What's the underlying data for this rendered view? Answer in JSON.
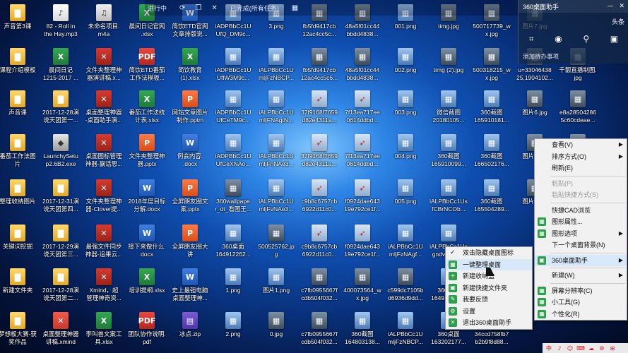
{
  "topbar": {
    "items": [
      "进行中",
      "已完成(所有任务)",
      "已完成 存任务"
    ],
    "icons": [
      "refresh-icon",
      "copy-icon",
      "close-icon",
      "grid-icon"
    ]
  },
  "helper": {
    "title": "360桌面助手",
    "sub": [
      "头条"
    ],
    "footer": "添加待办事项"
  },
  "desktop_icons": [
    {
      "label": "声音第3课",
      "type": "folder",
      "glyph": "▇"
    },
    {
      "label": "82 - Roll in\nthe Hay.mp3",
      "type": "mp3",
      "glyph": "♪"
    },
    {
      "label": "未命名项目.\nm4a",
      "type": "m4a",
      "glyph": "♫"
    },
    {
      "label": "晨间日记官网\n.xlsx",
      "type": "xlsx",
      "glyph": "X"
    },
    {
      "label": "简饮ETD官网\n文章排版说...",
      "type": "docx",
      "glyph": "W"
    },
    {
      "label": "iADPBbCc1U\nUfQ_DM9c...",
      "type": "png",
      "glyph": "▦"
    },
    {
      "label": "3.png",
      "type": "png",
      "glyph": "▦"
    },
    {
      "label": "fb5fd9417cb\n12ac4cc5c...",
      "type": "jpg",
      "glyph": "▦"
    },
    {
      "label": "48a5f01cc44\nbbdd4838...",
      "type": "jpg",
      "glyph": "▦"
    },
    {
      "label": "001.png",
      "type": "png",
      "glyph": "▦"
    },
    {
      "label": "timg.jpg",
      "type": "jpg",
      "glyph": "▦"
    },
    {
      "label": "500717739_w\nx.jpg",
      "type": "jpg",
      "glyph": "▦"
    },
    {
      "label": "图片7.jpg",
      "type": "jpg",
      "glyph": "▦"
    },
    {
      "label": "课程介绍模板",
      "type": "folder",
      "glyph": "▇"
    },
    {
      "label": "晨间日记\n1215-2017 ...",
      "type": "xlsx",
      "glyph": "X"
    },
    {
      "label": "文件夹整理神\n器演讲稿.x...",
      "type": "app",
      "glyph": "✕"
    },
    {
      "label": "简饮ETD番茄\n工作法模板...",
      "type": "pdf",
      "glyph": "PDF"
    },
    {
      "label": "简饮教育\n(1).xlsx",
      "type": "xlsx",
      "glyph": "X"
    },
    {
      "label": "iADPBbCc1U\nUflW3M9c...",
      "type": "png",
      "glyph": "▦"
    },
    {
      "label": "iALPBbCc1U\nmljFzNBCP...",
      "type": "png",
      "glyph": "▦"
    },
    {
      "label": "fb5fd9417cb\n12ac4cc5c6...",
      "type": "jpg",
      "glyph": "▦"
    },
    {
      "label": "48a5f01cc44\nbbdd4838...",
      "type": "jpg",
      "glyph": "▦"
    },
    {
      "label": "002.png",
      "type": "png",
      "glyph": "▦"
    },
    {
      "label": "timg (2).jpg",
      "type": "jpg",
      "glyph": "▦"
    },
    {
      "label": "500318215_w\nx.jpg",
      "type": "jpg",
      "glyph": "▦"
    },
    {
      "label": "u=33046438\n25,1904102...",
      "type": "jpg",
      "glyph": "▦"
    },
    {
      "label": "千靓直播制图.\njpg",
      "type": "jpg",
      "glyph": "▦"
    },
    {
      "label": "声音课",
      "type": "folder",
      "glyph": "▇"
    },
    {
      "label": "2017-12-28演\n说天团第一...",
      "type": "folder",
      "glyph": "▇"
    },
    {
      "label": "桌面整理神器\n-桌面助手演...",
      "type": "app",
      "glyph": "✕"
    },
    {
      "label": "番茄工作法统\n计表.xlsx",
      "type": "xlsx",
      "glyph": "X"
    },
    {
      "label": "网站文章图片\n制作.pptm",
      "type": "pptx",
      "glyph": "P"
    },
    {
      "label": "iADPBbCc1U\nUfCeTM9c...",
      "type": "png",
      "glyph": "▦"
    },
    {
      "label": "iALPBbCc1U\nmljFNAgtN...",
      "type": "png",
      "glyph": "▦"
    },
    {
      "label": "37f9168f7659\nd82e4311a...",
      "type": "rocket",
      "glyph": "➶"
    },
    {
      "label": "7f13ea717ee\n0614ddbd...",
      "type": "rocket",
      "glyph": "➶"
    },
    {
      "label": "003.png",
      "type": "png",
      "glyph": "▦"
    },
    {
      "label": "微信截图\n20180105...",
      "type": "png",
      "glyph": "▦"
    },
    {
      "label": "360截图\n165910181...",
      "type": "png",
      "glyph": "▦"
    },
    {
      "label": "图片6.jpg",
      "type": "jpg",
      "glyph": "▦"
    },
    {
      "label": "e8a28504286\n5c60cdeae...",
      "type": "jpg",
      "glyph": "▦"
    },
    {
      "label": "番茄工作法图\n片",
      "type": "folder",
      "glyph": "▇"
    },
    {
      "label": "LaunchySetu\np2.6B2.exe",
      "type": "exe",
      "glyph": "◆"
    },
    {
      "label": "桌面图标管理\n神器-赢话思...",
      "type": "app",
      "glyph": "✕"
    },
    {
      "label": "文件夹整理神\n器.pptx",
      "type": "pptx",
      "glyph": "P"
    },
    {
      "label": "例会内容.\n.docx",
      "type": "docx",
      "glyph": "W"
    },
    {
      "label": "iADPBbCc1U\nUfCeXNAo...",
      "type": "png",
      "glyph": "▦"
    },
    {
      "label": "iALPBbCc1U\nmljFnNAe3...",
      "type": "png",
      "glyph": "▦"
    },
    {
      "label": "37f9168f7659\nd82e4311a...",
      "type": "rocket",
      "glyph": "➶"
    },
    {
      "label": "7f13ea717ee\n0614ddbd...",
      "type": "rocket",
      "glyph": "➶"
    },
    {
      "label": "004.png",
      "type": "png",
      "glyph": "▦"
    },
    {
      "label": "360截图\n165910099...",
      "type": "png",
      "glyph": "▦"
    },
    {
      "label": "360截图\n166502176...",
      "type": "png",
      "glyph": "▦"
    },
    {
      "label": "图片8.jpg",
      "type": "jpg",
      "glyph": "▦"
    },
    {
      "label": "u=6579\n0,39132",
      "type": "jpg",
      "glyph": "▦"
    },
    {
      "label": "整理收纳图片",
      "type": "folder",
      "glyph": "▇"
    },
    {
      "label": "2017-12-31演\n说天团第四...",
      "type": "folder",
      "glyph": "▇"
    },
    {
      "label": "文件夹整理神\n器-Clover提...",
      "type": "app",
      "glyph": "✕"
    },
    {
      "label": "2018年度目标\n分解.docx",
      "type": "docx",
      "glyph": "W"
    },
    {
      "label": "全屏朗友圈文\n案.pptx",
      "type": "pptx",
      "glyph": "P"
    },
    {
      "label": "360wallpape\nr_dt_看图王...",
      "type": "jpg",
      "glyph": "▦"
    },
    {
      "label": "iALPBbCc1U\nmljFvNAe3...",
      "type": "png",
      "glyph": "▦"
    },
    {
      "label": "c9b8c6757cb\n6922d11c0...",
      "type": "rocket",
      "glyph": "➶"
    },
    {
      "label": "f0924dae643\n19e792ce1f...",
      "type": "rocket",
      "glyph": "➶"
    },
    {
      "label": "005.png",
      "type": "png",
      "glyph": "▦"
    },
    {
      "label": "iALPBbCc1Us\nfCBrNCOb...",
      "type": "png",
      "glyph": "▦"
    },
    {
      "label": "360截图\n165504289...",
      "type": "png",
      "glyph": "▦"
    },
    {
      "label": "图片9.jpg",
      "type": "jpg",
      "glyph": "▦"
    },
    {
      "label": "logo.p",
      "type": "png",
      "glyph": "▦"
    },
    {
      "label": "关键词挖掘",
      "type": "folder",
      "glyph": "▇"
    },
    {
      "label": "2017-12-29演\n说天团第三...",
      "type": "folder",
      "glyph": "▇"
    },
    {
      "label": "最强文件同步\n神器-追果云...",
      "type": "app",
      "glyph": "✕"
    },
    {
      "label": "接下来做什么.\ndocx",
      "type": "docx",
      "glyph": "W"
    },
    {
      "label": "全屏朗友圈大讲\n案.pptm",
      "type": "pptx",
      "glyph": "P"
    },
    {
      "label": "360桌面\n164912262...",
      "type": "png",
      "glyph": "▦"
    },
    {
      "label": "500525762.jp\ng",
      "type": "jpg",
      "glyph": "▦"
    },
    {
      "label": "c9b8c6757cb\n6922d11c0...",
      "type": "rocket",
      "glyph": "➶"
    },
    {
      "label": "f0924dae643\n19e792ce1f...",
      "type": "rocket",
      "glyph": "➶"
    },
    {
      "label": "iALPBbCc1U\nmljFzNAgf...",
      "type": "png",
      "glyph": "▦"
    },
    {
      "label": "iALPBbCc1Us\ngndvNCZv...",
      "type": "png",
      "glyph": "▦"
    },
    {
      "label": "新建文件夹",
      "type": "folder",
      "glyph": "▇"
    },
    {
      "label": "2017-12-28演\n说天团第二...",
      "type": "folder",
      "glyph": "▇"
    },
    {
      "label": "Xmind，超\n管理神奇资...",
      "type": "app",
      "glyph": "✕"
    },
    {
      "label": "培训提纲.xlsx",
      "type": "xlsx",
      "glyph": "X"
    },
    {
      "label": "史上最强电脑\n桌面整理神...",
      "type": "docx",
      "glyph": "W"
    },
    {
      "label": "1.png",
      "type": "png",
      "glyph": "▦"
    },
    {
      "label": "图片1.png",
      "type": "png",
      "glyph": "▦"
    },
    {
      "label": "c7fb0955667f\ncdb504f032...",
      "type": "jpg",
      "glyph": "▦"
    },
    {
      "label": "400073564_w\nx.jpg",
      "type": "jpg",
      "glyph": "▦"
    },
    {
      "label": "c599dc7105b\nd6936d9dd...",
      "type": "jpg",
      "glyph": "▦"
    },
    {
      "label": "360桌面\n164912221...",
      "type": "png",
      "glyph": "▦"
    },
    {
      "label": "梦想板大赛-获\n奖作品",
      "type": "folder",
      "glyph": "▇"
    },
    {
      "label": "桌面整理神器\n讲稿.xmind",
      "type": "xmind",
      "glyph": "✕"
    },
    {
      "label": "李叫兽文案工\n具.xlsx",
      "type": "xlsx",
      "glyph": "X"
    },
    {
      "label": "团队协作说明.\npdf",
      "type": "pdf",
      "glyph": "PDF"
    },
    {
      "label": "冰点.zip",
      "type": "zip",
      "glyph": "▤"
    },
    {
      "label": "2.png",
      "type": "png",
      "glyph": "▦"
    },
    {
      "label": "0.jpg",
      "type": "jpg",
      "glyph": "▦"
    },
    {
      "label": "c7fb0955667f\ncdb504f032...",
      "type": "jpg",
      "glyph": "▦"
    },
    {
      "label": "360截图\n164803138...",
      "type": "png",
      "glyph": "▦"
    },
    {
      "label": "iALPBbCc1U\nmljFzNBCP...",
      "type": "png",
      "glyph": "▦"
    },
    {
      "label": "360桌面\n163202177...",
      "type": "png",
      "glyph": "▦"
    },
    {
      "label": "34ccd758fb7\nb2b9f8d88...",
      "type": "jpg",
      "glyph": "▦"
    },
    {
      "label": "u=73796655\n3,29294495...",
      "type": "jpg",
      "glyph": "▦"
    }
  ],
  "submenu": {
    "items": [
      {
        "label": "双击隐藏桌面图标",
        "checked": true
      },
      {
        "label": "一键整理桌面",
        "icon": "▦",
        "hl": true
      },
      {
        "label": "新建收纳盒",
        "icon": "+"
      },
      {
        "label": "新建快捷文件夹",
        "icon": "▣"
      },
      {
        "label": "我要反馈",
        "icon": "✎"
      },
      {
        "label": "设置",
        "icon": "⚙"
      },
      {
        "label": "退出360桌面助手",
        "icon": "✕"
      }
    ]
  },
  "context_menu": {
    "items": [
      {
        "label": "查看(V)",
        "arrow": true
      },
      {
        "label": "排序方式(O)",
        "arrow": true
      },
      {
        "label": "刷新(E)"
      },
      {
        "sep": true
      },
      {
        "label": "粘贴(P)",
        "disabled": true
      },
      {
        "label": "粘贴快捷方式(S)",
        "disabled": true
      },
      {
        "sep": true
      },
      {
        "label": "快捷CAD浏览"
      },
      {
        "label": "图形属性...",
        "icon": "▦"
      },
      {
        "label": "图形选项",
        "icon": "▦",
        "arrow": true
      },
      {
        "label": "下一个桌面背景(N)"
      },
      {
        "sep": true
      },
      {
        "label": "360桌面助手",
        "icon": "▣",
        "arrow": true,
        "hl": true
      },
      {
        "sep": true
      },
      {
        "label": "新建(W)",
        "arrow": true
      },
      {
        "sep": true
      },
      {
        "label": "屏幕分辨率(C)",
        "icon": "▦"
      },
      {
        "label": "小工具(G)",
        "icon": "▦"
      },
      {
        "label": "个性化(R)",
        "icon": "▦"
      }
    ]
  },
  "tray": [
    "中",
    "♪",
    "☺",
    "⌨",
    "☁",
    "⚙",
    "⊞"
  ],
  "colors": {
    "accent": "#2f9f4d",
    "menu_bg": "#f1f1f1",
    "highlight": "#d7e8fb"
  }
}
